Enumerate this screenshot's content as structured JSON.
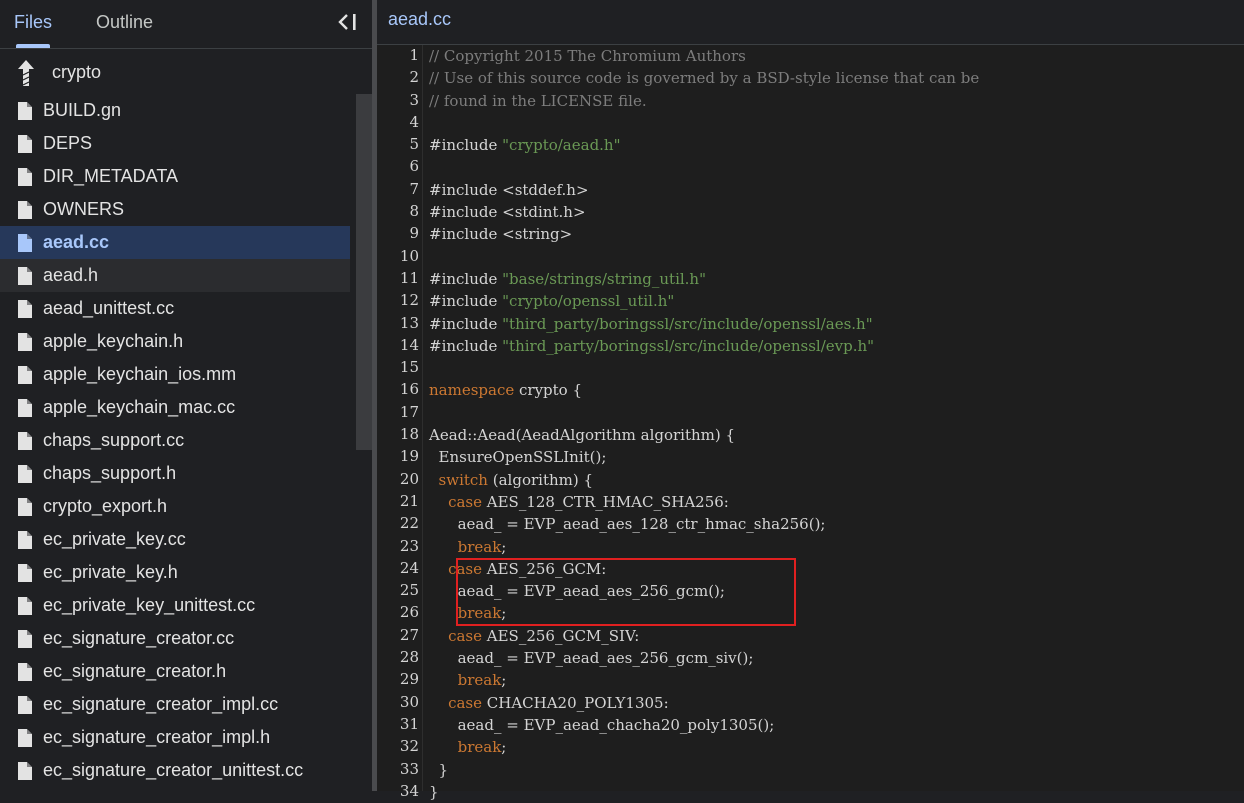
{
  "tabs": {
    "files": "Files",
    "outline": "Outline"
  },
  "current_dir": "crypto",
  "files": [
    "BUILD.gn",
    "DEPS",
    "DIR_METADATA",
    "OWNERS",
    "aead.cc",
    "aead.h",
    "aead_unittest.cc",
    "apple_keychain.h",
    "apple_keychain_ios.mm",
    "apple_keychain_mac.cc",
    "chaps_support.cc",
    "chaps_support.h",
    "crypto_export.h",
    "ec_private_key.cc",
    "ec_private_key.h",
    "ec_private_key_unittest.cc",
    "ec_signature_creator.cc",
    "ec_signature_creator.h",
    "ec_signature_creator_impl.cc",
    "ec_signature_creator_impl.h",
    "ec_signature_creator_unittest.cc"
  ],
  "selected_file": "aead.cc",
  "hovered_file": "aead.h",
  "editor": {
    "title": "aead.cc",
    "lines": [
      [
        [
          "c",
          "// Copyright 2015 The Chromium Authors"
        ]
      ],
      [
        [
          "c",
          "// Use of this source code is governed by a BSD-style license that can be"
        ]
      ],
      [
        [
          "c",
          "// found in the LICENSE file."
        ]
      ],
      [],
      [
        [
          "p",
          "#include "
        ],
        [
          "s",
          "\"crypto/aead.h\""
        ]
      ],
      [],
      [
        [
          "p",
          "#include <stddef.h>"
        ]
      ],
      [
        [
          "p",
          "#include <stdint.h>"
        ]
      ],
      [
        [
          "p",
          "#include <string>"
        ]
      ],
      [],
      [
        [
          "p",
          "#include "
        ],
        [
          "s",
          "\"base/strings/string_util.h\""
        ]
      ],
      [
        [
          "p",
          "#include "
        ],
        [
          "s",
          "\"crypto/openssl_util.h\""
        ]
      ],
      [
        [
          "p",
          "#include "
        ],
        [
          "s",
          "\"third_party/boringssl/src/include/openssl/aes.h\""
        ]
      ],
      [
        [
          "p",
          "#include "
        ],
        [
          "s",
          "\"third_party/boringssl/src/include/openssl/evp.h\""
        ]
      ],
      [],
      [
        [
          "k",
          "namespace"
        ],
        [
          "p",
          " crypto {"
        ]
      ],
      [],
      [
        [
          "p",
          "Aead::Aead(AeadAlgorithm algorithm) {"
        ]
      ],
      [
        [
          "p",
          "  EnsureOpenSSLInit();"
        ]
      ],
      [
        [
          "p",
          "  "
        ],
        [
          "k",
          "switch"
        ],
        [
          "p",
          " (algorithm) {"
        ]
      ],
      [
        [
          "p",
          "    "
        ],
        [
          "k",
          "case"
        ],
        [
          "p",
          " AES_128_CTR_HMAC_SHA256:"
        ]
      ],
      [
        [
          "p",
          "      aead_ = EVP_aead_aes_128_ctr_hmac_sha256();"
        ]
      ],
      [
        [
          "p",
          "      "
        ],
        [
          "k",
          "break"
        ],
        [
          "p",
          ";"
        ]
      ],
      [
        [
          "p",
          "    "
        ],
        [
          "k",
          "case"
        ],
        [
          "p",
          " AES_256_GCM:"
        ]
      ],
      [
        [
          "p",
          "      aead_ = EVP_aead_aes_256_gcm();"
        ]
      ],
      [
        [
          "p",
          "      "
        ],
        [
          "k",
          "break"
        ],
        [
          "p",
          ";"
        ]
      ],
      [
        [
          "p",
          "    "
        ],
        [
          "k",
          "case"
        ],
        [
          "p",
          " AES_256_GCM_SIV:"
        ]
      ],
      [
        [
          "p",
          "      aead_ = EVP_aead_aes_256_gcm_siv();"
        ]
      ],
      [
        [
          "p",
          "      "
        ],
        [
          "k",
          "break"
        ],
        [
          "p",
          ";"
        ]
      ],
      [
        [
          "p",
          "    "
        ],
        [
          "k",
          "case"
        ],
        [
          "p",
          " CHACHA20_POLY1305:"
        ]
      ],
      [
        [
          "p",
          "      aead_ = EVP_aead_chacha20_poly1305();"
        ]
      ],
      [
        [
          "p",
          "      "
        ],
        [
          "k",
          "break"
        ],
        [
          "p",
          ";"
        ]
      ],
      [
        [
          "p",
          "  }"
        ]
      ],
      [
        [
          "p",
          "}"
        ]
      ]
    ]
  },
  "colors": {
    "accent": "#a8c7fa",
    "highlight_box": "#e02020",
    "keyword": "#cc7832",
    "string": "#6a9955",
    "comment": "#7d7d7d"
  }
}
